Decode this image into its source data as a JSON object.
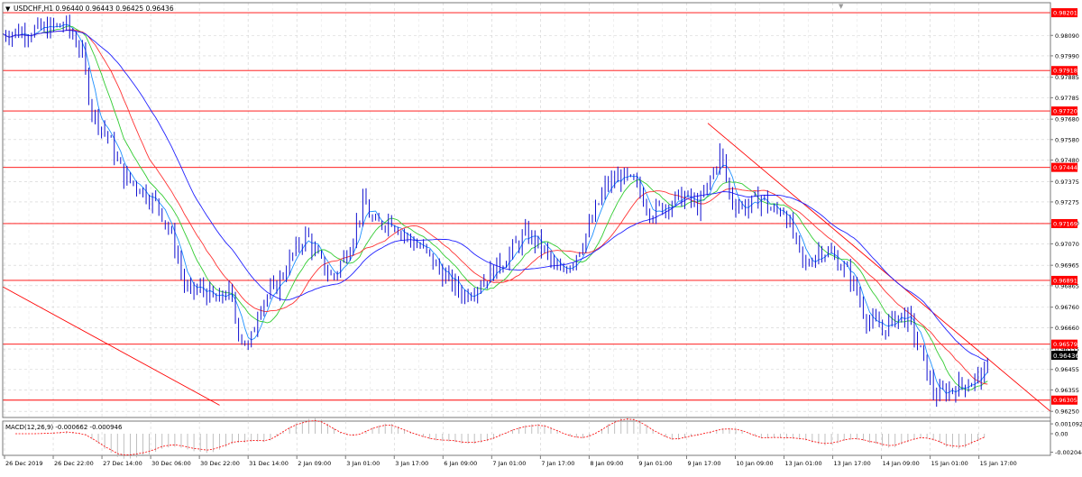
{
  "chart_data": [
    {
      "type": "line",
      "header": "USDCHF,H1  0.96440 0.96443 0.96425 0.96436",
      "y_ticks": [
        "0.98090",
        "0.97990",
        "0.97885",
        "0.97785",
        "0.97680",
        "0.97580",
        "0.97480",
        "0.97375",
        "0.97275",
        "0.97170",
        "0.97070",
        "0.96965",
        "0.96865",
        "0.96760",
        "0.96660",
        "0.96555",
        "0.96455",
        "0.96355",
        "0.96250"
      ],
      "ylim": [
        0.9622,
        0.9825
      ],
      "price_label": "0.96436",
      "levels": [
        {
          "label": "0.98201",
          "value": 0.98201
        },
        {
          "label": "0.97918",
          "value": 0.97918
        },
        {
          "label": "0.97720",
          "value": 0.9772
        },
        {
          "label": "0.97444",
          "value": 0.97444
        },
        {
          "label": "0.97169",
          "value": 0.97169
        },
        {
          "label": "0.96891",
          "value": 0.96891
        },
        {
          "label": "0.96579",
          "value": 0.96579
        },
        {
          "label": "0.96305",
          "value": 0.96305
        }
      ],
      "trendlines": [
        {
          "from": [
            0,
            0.9686
          ],
          "to": [
            0.207,
            0.9628
          ]
        },
        {
          "from": [
            0.673,
            0.9766
          ],
          "to": [
            1.0,
            0.9625
          ]
        }
      ],
      "x_ticks": [
        "26 Dec 2019",
        "26 Dec 22:00",
        "27 Dec 14:00",
        "30 Dec 06:00",
        "30 Dec 22:00",
        "31 Dec 14:00",
        "2 Jan 09:00",
        "3 Jan 01:00",
        "3 Jan 17:00",
        "6 Jan 09:00",
        "7 Jan 01:00",
        "7 Jan 17:00",
        "8 Jan 09:00",
        "9 Jan 01:00",
        "9 Jan 17:00",
        "10 Jan 09:00",
        "13 Jan 01:00",
        "13 Jan 17:00",
        "14 Jan 09:00",
        "15 Jan 01:00",
        "15 Jan 17:00"
      ],
      "price_keypoints": [
        [
          0,
          0.981
        ],
        [
          0.04,
          0.9812
        ],
        [
          0.06,
          0.9814
        ],
        [
          0.075,
          0.9802
        ],
        [
          0.085,
          0.9772
        ],
        [
          0.1,
          0.976
        ],
        [
          0.115,
          0.974
        ],
        [
          0.13,
          0.9735
        ],
        [
          0.15,
          0.9725
        ],
        [
          0.165,
          0.9705
        ],
        [
          0.175,
          0.9683
        ],
        [
          0.19,
          0.9685
        ],
        [
          0.205,
          0.9678
        ],
        [
          0.215,
          0.9685
        ],
        [
          0.225,
          0.9665
        ],
        [
          0.235,
          0.9655
        ],
        [
          0.245,
          0.9678
        ],
        [
          0.26,
          0.9685
        ],
        [
          0.275,
          0.97
        ],
        [
          0.29,
          0.9712
        ],
        [
          0.3,
          0.97
        ],
        [
          0.315,
          0.969
        ],
        [
          0.33,
          0.9705
        ],
        [
          0.345,
          0.9728
        ],
        [
          0.355,
          0.9715
        ],
        [
          0.37,
          0.972
        ],
        [
          0.385,
          0.971
        ],
        [
          0.4,
          0.9705
        ],
        [
          0.42,
          0.9692
        ],
        [
          0.44,
          0.9682
        ],
        [
          0.46,
          0.969
        ],
        [
          0.48,
          0.97
        ],
        [
          0.5,
          0.9712
        ],
        [
          0.515,
          0.9705
        ],
        [
          0.53,
          0.9692
        ],
        [
          0.545,
          0.97
        ],
        [
          0.56,
          0.9715
        ],
        [
          0.575,
          0.9735
        ],
        [
          0.59,
          0.974
        ],
        [
          0.605,
          0.9735
        ],
        [
          0.62,
          0.9722
        ],
        [
          0.635,
          0.9727
        ],
        [
          0.65,
          0.973
        ],
        [
          0.665,
          0.9725
        ],
        [
          0.675,
          0.9738
        ],
        [
          0.685,
          0.9752
        ],
        [
          0.695,
          0.9728
        ],
        [
          0.71,
          0.9725
        ],
        [
          0.725,
          0.973
        ],
        [
          0.735,
          0.9722
        ],
        [
          0.745,
          0.9725
        ],
        [
          0.755,
          0.971
        ],
        [
          0.765,
          0.9695
        ],
        [
          0.78,
          0.9705
        ],
        [
          0.795,
          0.97
        ],
        [
          0.81,
          0.969
        ],
        [
          0.825,
          0.967
        ],
        [
          0.84,
          0.9665
        ],
        [
          0.855,
          0.9672
        ],
        [
          0.865,
          0.967
        ],
        [
          0.875,
          0.9655
        ],
        [
          0.885,
          0.964
        ],
        [
          0.89,
          0.9632
        ],
        [
          0.9,
          0.9635
        ],
        [
          0.91,
          0.9637
        ],
        [
          0.925,
          0.964
        ],
        [
          0.935,
          0.9643
        ],
        [
          0.94,
          0.96436
        ]
      ],
      "moving_averages": [
        {
          "color": "#1e90ff",
          "period": 5
        },
        {
          "color": "#33cc33",
          "period": 12
        },
        {
          "color": "#ff3333",
          "period": 20
        },
        {
          "color": "#2222ff",
          "period": 34
        }
      ],
      "line_color": "#1010d0",
      "level_color": "#ff0000",
      "label_bg": "#ff0000"
    },
    {
      "type": "bar",
      "header": "MACD(12,26,9) -0.000662 -0.000946",
      "y_ticks": [
        "0.001092",
        "0.00",
        "-0.002044"
      ],
      "ylim": [
        -0.0024,
        0.0014
      ],
      "histogram_color": "#b0b0b0",
      "signal_color": "#ff0000"
    }
  ]
}
